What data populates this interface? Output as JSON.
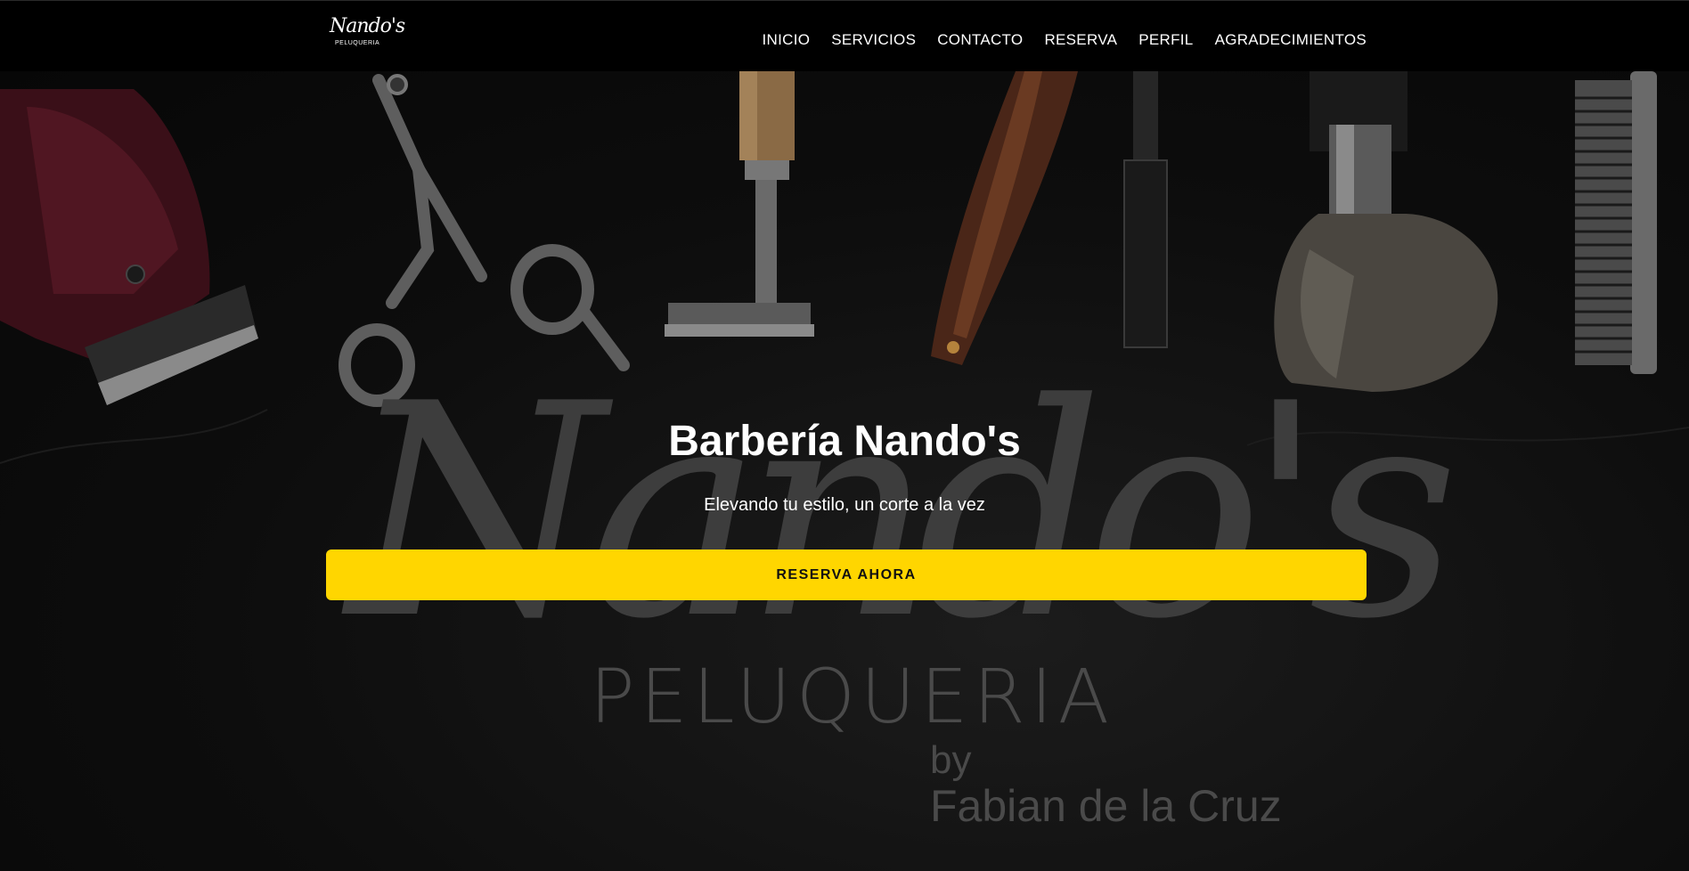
{
  "nav": {
    "logo": {
      "script": "Nando's",
      "sub": "PELUQUERIA"
    },
    "links": [
      "INICIO",
      "SERVICIOS",
      "CONTACTO",
      "RESERVA",
      "PERFIL",
      "AGRADECIMIENTOS"
    ]
  },
  "hero": {
    "title": "Barbería Nando's",
    "subtitle": "Elevando tu estilo, un corte a la vez",
    "cta_label": "RESERVA AHORA",
    "watermark": {
      "script": "Nando's",
      "peluqueria": "PELUQUERIA",
      "by": "by",
      "author": "Fabian de la Cruz"
    },
    "tool_icons": [
      "hair-clipper-icon",
      "scissors-icon",
      "safety-razor-icon",
      "straight-razor-icon",
      "razor-blade-icon",
      "shaving-brush-icon",
      "comb-icon"
    ]
  },
  "colors": {
    "navbar": "#000000",
    "background": "#0a0a0a",
    "accent": "#ffd600",
    "text": "#ffffff",
    "watermark": "#4a4a4a"
  }
}
